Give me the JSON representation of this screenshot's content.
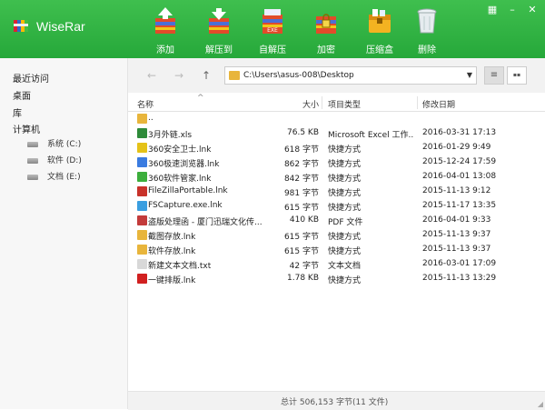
{
  "app": {
    "name": "WiseRar"
  },
  "toolbar": [
    {
      "label": "添加",
      "icon": "add-icon"
    },
    {
      "label": "解压到",
      "icon": "extract-to-icon"
    },
    {
      "label": "自解压",
      "icon": "self-extract-icon"
    },
    {
      "label": "加密",
      "icon": "encrypt-icon"
    },
    {
      "label": "压缩盒",
      "icon": "compress-box-icon"
    },
    {
      "label": "删除",
      "icon": "delete-icon"
    }
  ],
  "window_controls": [
    "▦",
    "–",
    "✕"
  ],
  "sidebar": {
    "recent": "最近访问",
    "desktop": "桌面",
    "library": "库",
    "computer": "计算机",
    "drives": [
      "系统 (C:)",
      "软件 (D:)",
      "文档 (E:)"
    ]
  },
  "nav": {
    "back": "←",
    "forward": "→",
    "up": "↑",
    "path": "C:\\Users\\asus-008\\Desktop",
    "dropdown": "▼",
    "view_list": "≡",
    "view_grid": "▪▪"
  },
  "columns": {
    "name": "名称",
    "size": "大小",
    "type": "项目类型",
    "date": "修改日期",
    "sort_arrow": "^"
  },
  "files": [
    {
      "name": "..",
      "size": "",
      "type": "",
      "date": ""
    },
    {
      "name": "3月外链.xls",
      "size": "76.5 KB",
      "type": "Microsoft Excel 工作...",
      "date": "2016-03-31 17:13"
    },
    {
      "name": "360安全卫士.lnk",
      "size": "618 字节",
      "type": "快捷方式",
      "date": "2016-01-29 9:49"
    },
    {
      "name": "360极速浏览器.lnk",
      "size": "862 字节",
      "type": "快捷方式",
      "date": "2015-12-24 17:59"
    },
    {
      "name": "360软件管家.lnk",
      "size": "842 字节",
      "type": "快捷方式",
      "date": "2016-04-01 13:08"
    },
    {
      "name": "FileZillaPortable.lnk",
      "size": "981 字节",
      "type": "快捷方式",
      "date": "2015-11-13 9:12"
    },
    {
      "name": "FSCapture.exe.lnk",
      "size": "615 字节",
      "type": "快捷方式",
      "date": "2015-11-17 13:35"
    },
    {
      "name": "盗版处理函 - 厦门迅瑞文化传...",
      "size": "410 KB",
      "type": "PDF 文件",
      "date": "2016-04-01 9:33"
    },
    {
      "name": "截图存放.lnk",
      "size": "615 字节",
      "type": "快捷方式",
      "date": "2015-11-13 9:37"
    },
    {
      "name": "软件存放.lnk",
      "size": "615 字节",
      "type": "快捷方式",
      "date": "2015-11-13 9:37"
    },
    {
      "name": "新建文本文档.txt",
      "size": "42 字节",
      "type": "文本文档",
      "date": "2016-03-01 17:09"
    },
    {
      "name": "一键排版.lnk",
      "size": "1.78 KB",
      "type": "快捷方式",
      "date": "2015-11-13 13:29"
    }
  ],
  "file_icon_colors": [
    "#e8b53c",
    "#2e8b3a",
    "#e5c218",
    "#3a7be0",
    "#3cae3c",
    "#c8322a",
    "#3a9ee0",
    "#c33b3b",
    "#e8b53c",
    "#e8b53c",
    "#d8d8d8",
    "#d12020"
  ],
  "status": {
    "text": "总计  506,153 字节(11 文件)"
  },
  "colors": {
    "accent": "#2db443",
    "sidebar_bg": "#f7f7f7"
  }
}
